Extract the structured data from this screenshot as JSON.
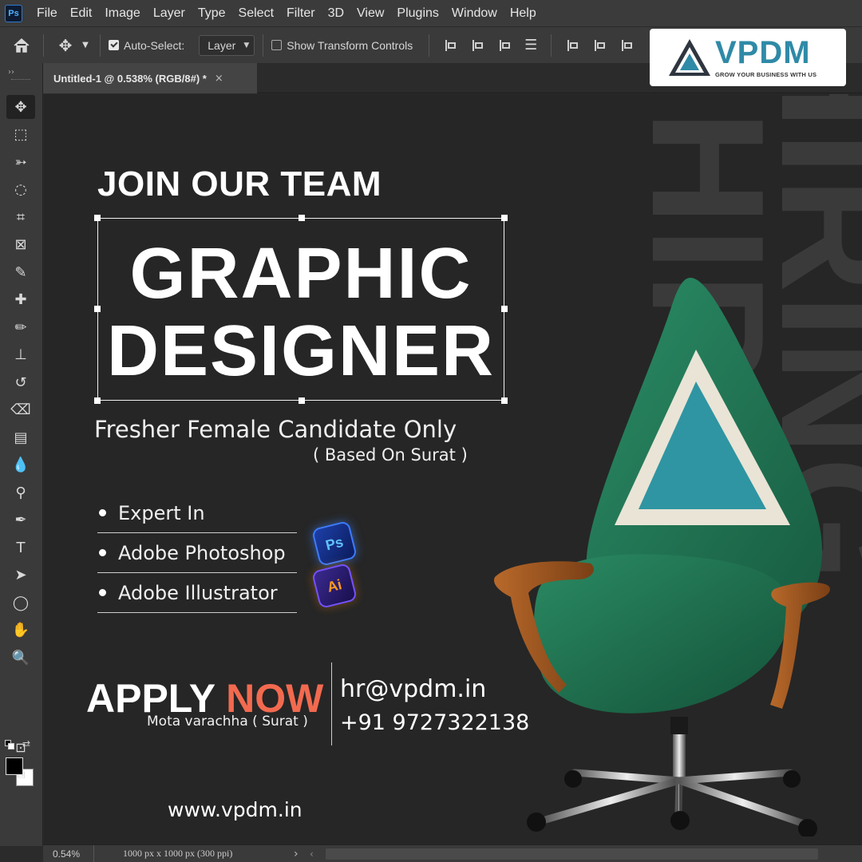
{
  "app": {
    "logo_text": "Ps",
    "menu": [
      "File",
      "Edit",
      "Image",
      "Layer",
      "Type",
      "Select",
      "Filter",
      "3D",
      "View",
      "Plugins",
      "Window",
      "Help"
    ]
  },
  "options": {
    "auto_select_label": "Auto-Select:",
    "auto_select_checked": true,
    "layer_select_value": "Layer",
    "show_transform_label": "Show Transform Controls",
    "show_transform_checked": false
  },
  "document": {
    "tab_title": "Untitled-1 @ 0.538% (RGB/8#) *",
    "close_glyph": "×"
  },
  "tools": [
    {
      "name": "move-tool-icon",
      "glyph": "✥",
      "active": true
    },
    {
      "name": "marquee-tool-icon",
      "glyph": "⬚"
    },
    {
      "name": "lasso-tool-icon",
      "glyph": "➳"
    },
    {
      "name": "quick-selection-tool-icon",
      "glyph": "◌"
    },
    {
      "name": "crop-tool-icon",
      "glyph": "⌗"
    },
    {
      "name": "frame-tool-icon",
      "glyph": "⊠"
    },
    {
      "name": "eyedropper-tool-icon",
      "glyph": "✎"
    },
    {
      "name": "healing-brush-tool-icon",
      "glyph": "✚"
    },
    {
      "name": "brush-tool-icon",
      "glyph": "✏"
    },
    {
      "name": "clone-stamp-tool-icon",
      "glyph": "⊥"
    },
    {
      "name": "history-brush-tool-icon",
      "glyph": "↺"
    },
    {
      "name": "eraser-tool-icon",
      "glyph": "⌫"
    },
    {
      "name": "gradient-tool-icon",
      "glyph": "▤"
    },
    {
      "name": "blur-tool-icon",
      "glyph": "💧"
    },
    {
      "name": "dodge-tool-icon",
      "glyph": "⚲"
    },
    {
      "name": "pen-tool-icon",
      "glyph": "✒"
    },
    {
      "name": "type-tool-icon",
      "glyph": "T"
    },
    {
      "name": "path-selection-tool-icon",
      "glyph": "➤"
    },
    {
      "name": "ellipse-tool-icon",
      "glyph": "◯"
    },
    {
      "name": "hand-tool-icon",
      "glyph": "✋"
    },
    {
      "name": "zoom-tool-icon",
      "glyph": "🔍"
    }
  ],
  "colors": {
    "foreground": "#000000",
    "background": "#ffffff",
    "accent": "#f26a4f",
    "brand": "#2f8aa7",
    "chair_green": "#1f6a4e"
  },
  "poster": {
    "background_word": "HIRING",
    "join_title": "JOIN OUR TEAM",
    "role_line1": "GRAPHIC",
    "role_line2": "DESIGNER",
    "candidate": "Fresher Female Candidate Only",
    "location_note": "( Based On Surat )",
    "skills": [
      "Expert In",
      "Adobe Photoshop",
      "Adobe Illustrator"
    ],
    "ps_badge": "Ps",
    "ai_badge": "Ai",
    "apply_word": "APPLY",
    "apply_now": "NOW",
    "apply_location": "Mota varachha ( Surat )",
    "email": "hr@vpdm.in",
    "phone": "+91 9727322138",
    "website": "www.vpdm.in"
  },
  "brand": {
    "name": "VPDM",
    "tagline": "GROW YOUR BUSINESS WITH US"
  },
  "status": {
    "zoom": "0.54%",
    "doc_info": "1000 px x 1000 px (300 ppi)",
    "arrow": "›",
    "scroll_left": "‹"
  }
}
